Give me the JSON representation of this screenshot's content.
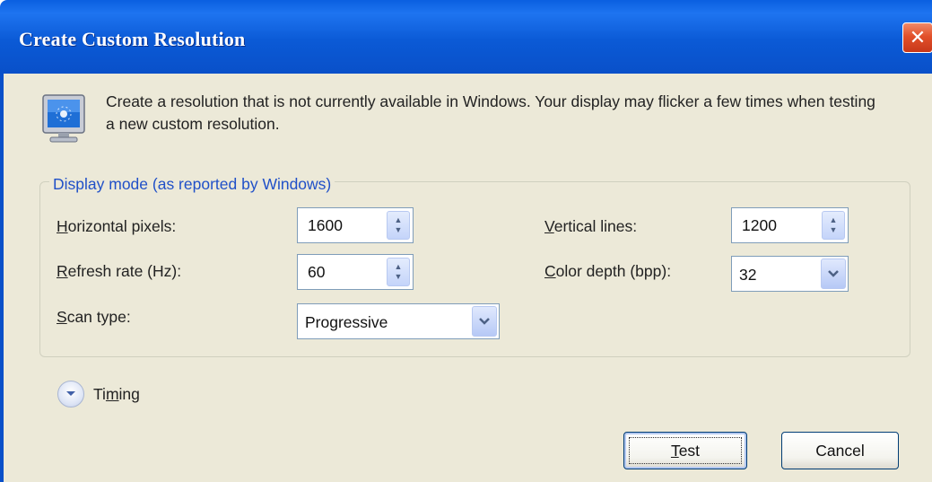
{
  "window": {
    "title": "Create Custom Resolution",
    "close_glyph": "✕"
  },
  "intro": {
    "icon": "monitor-icon",
    "text": "Create a resolution that is not currently available in Windows. Your display may flicker a few times when testing a new custom resolution."
  },
  "display_mode": {
    "legend": "Display mode (as reported by Windows)",
    "horizontal_pixels": {
      "ak": "H",
      "rest": "orizontal pixels:",
      "value": "1600"
    },
    "vertical_lines": {
      "ak": "V",
      "rest": "ertical lines:",
      "value": "1200"
    },
    "refresh_rate": {
      "ak": "R",
      "rest": "efresh rate (Hz):",
      "value": "60"
    },
    "color_depth": {
      "ak": "C",
      "rest": "olor depth (bpp):",
      "value": "32"
    },
    "scan_type": {
      "ak": "S",
      "rest": "can type:",
      "value": "Progressive"
    }
  },
  "timing": {
    "pre": "Ti",
    "ak": "m",
    "post": "ing"
  },
  "buttons": {
    "test": {
      "ak": "T",
      "rest": "est"
    },
    "cancel": "Cancel"
  },
  "colors": {
    "titlebar": "#0a5fe0",
    "client_background": "#ece9d8",
    "legend_text": "#2050c8",
    "close_button": "#e2502a"
  }
}
